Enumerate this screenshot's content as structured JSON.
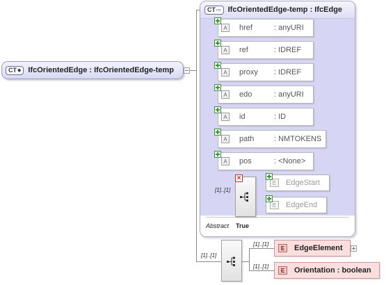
{
  "root_type": {
    "badge": "CT",
    "label": "IfcOrientedEdge : IfcOrientedEdge-temp"
  },
  "base_type": {
    "badge": "CT",
    "label": "IfcOrientedEdge-temp : IfcEdge",
    "abstract_key": "Abstract",
    "abstract_value": "True"
  },
  "attributes": [
    {
      "badge": "A",
      "name": "href",
      "type": ": anyURI"
    },
    {
      "badge": "A",
      "name": "ref",
      "type": ": IDREF"
    },
    {
      "badge": "A",
      "name": "proxy",
      "type": ": IDREF"
    },
    {
      "badge": "A",
      "name": "edo",
      "type": ": anyURI"
    },
    {
      "badge": "A",
      "name": "id",
      "type": ": ID"
    },
    {
      "badge": "A",
      "name": "path",
      "type": ": NMTOKENS"
    },
    {
      "badge": "A",
      "name": "pos",
      "type": ": <None>"
    }
  ],
  "inner_sequence": {
    "cardinality": "[1]..[1]",
    "elements": [
      {
        "badge": "E",
        "name": "EdgeStart"
      },
      {
        "badge": "E",
        "name": "EdgeEnd"
      }
    ]
  },
  "outer_sequence": {
    "cardinality": "[1]..[1]",
    "elements": [
      {
        "badge": "E",
        "name": "EdgeElement",
        "cardinality": "[1]..[1]"
      },
      {
        "badge": "E",
        "name": "Orientation : boolean",
        "cardinality": "[1]..[1]"
      }
    ]
  }
}
